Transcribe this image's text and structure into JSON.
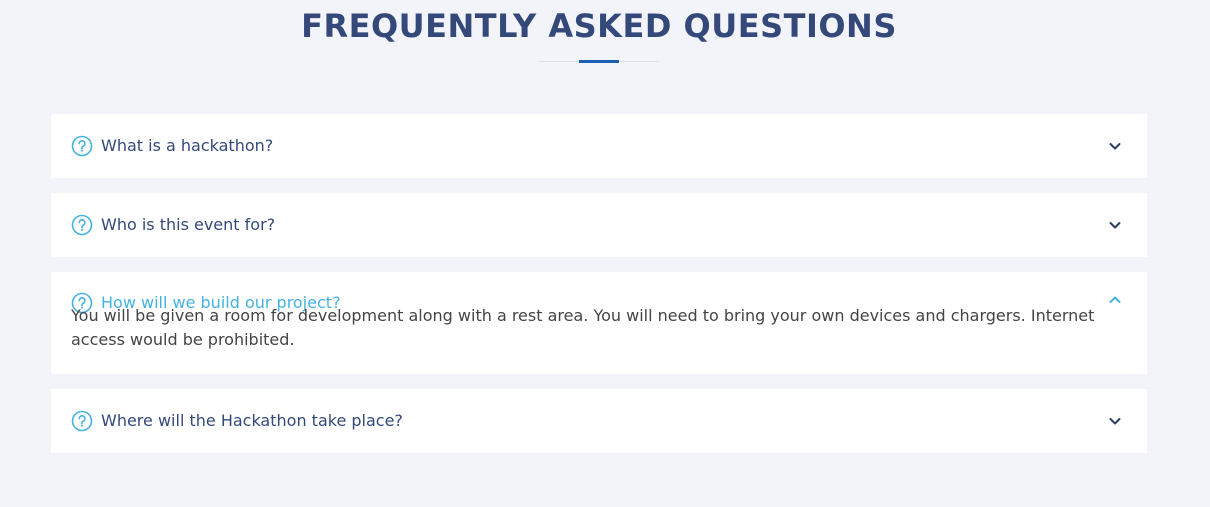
{
  "section": {
    "title": "FREQUENTLY ASKED QUESTIONS"
  },
  "colors": {
    "title": "#34497a",
    "accent": "#1a5fb4",
    "active_question": "#45b3e0",
    "icon": "#45b3e0",
    "background": "#f3f4f9"
  },
  "faq": [
    {
      "question": "What is a hackathon?",
      "expanded": false,
      "icon": "question-circle-icon",
      "toggle_icon": "chevron-down-icon"
    },
    {
      "question": "Who is this event for?",
      "expanded": false,
      "icon": "question-circle-icon",
      "toggle_icon": "chevron-down-icon"
    },
    {
      "question": "How will we build our project?",
      "expanded": true,
      "answer": "You will be given a room for development along with a rest area. You will need to bring your own devices and chargers. Internet access would be prohibited.",
      "icon": "question-circle-icon",
      "toggle_icon": "chevron-up-icon"
    },
    {
      "question": "Where will the Hackathon take place?",
      "expanded": false,
      "icon": "question-circle-icon",
      "toggle_icon": "chevron-down-icon"
    }
  ]
}
